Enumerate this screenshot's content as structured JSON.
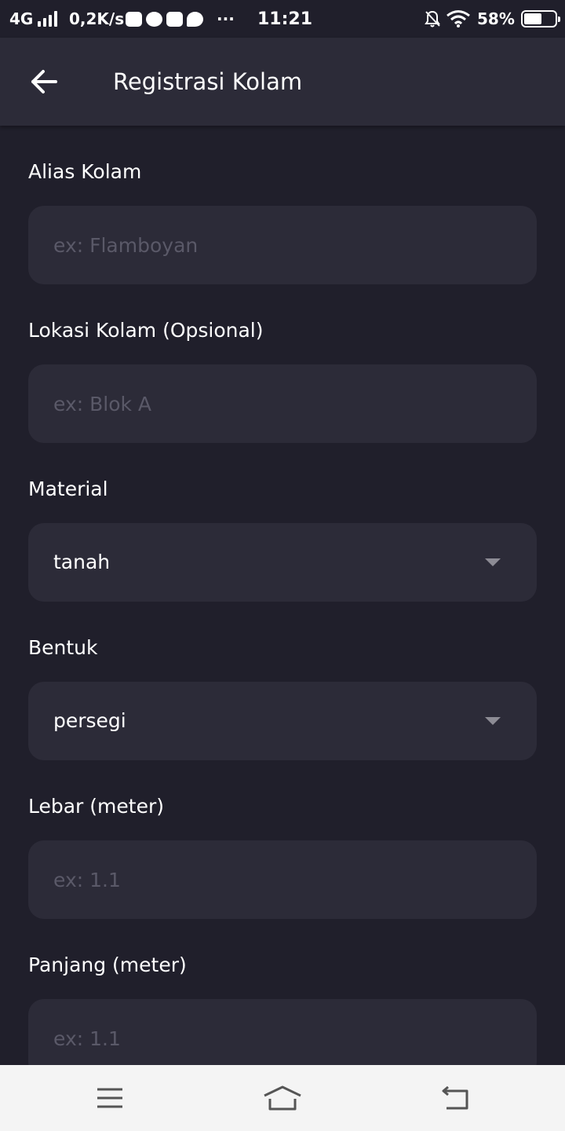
{
  "status_bar": {
    "network": "4G",
    "speed": "0,2K/s",
    "more": "···",
    "time": "11:21",
    "battery": "58%",
    "battery_level": 0.58
  },
  "app_bar": {
    "title": "Registrasi Kolam",
    "back_icon": "arrow-left-icon"
  },
  "form": {
    "alias": {
      "label": "Alias Kolam",
      "placeholder": "ex: Flamboyan",
      "value": ""
    },
    "lokasi": {
      "label": "Lokasi Kolam (Opsional)",
      "placeholder": "ex: Blok A",
      "value": ""
    },
    "material": {
      "label": "Material",
      "selected": "tanah"
    },
    "bentuk": {
      "label": "Bentuk",
      "selected": "persegi"
    },
    "lebar": {
      "label": "Lebar (meter)",
      "placeholder": "ex: 1.1",
      "value": ""
    },
    "panjang": {
      "label": "Panjang (meter)",
      "placeholder": "ex: 1.1",
      "value": ""
    }
  },
  "nav_bar": {
    "icons": [
      "menu-icon",
      "home-icon",
      "back-icon"
    ]
  },
  "colors": {
    "background": "#201f2b",
    "surface": "#2c2b38",
    "text": "#ffffff",
    "placeholder": "#5a5968",
    "nav_bar": "#f4f4f4"
  }
}
